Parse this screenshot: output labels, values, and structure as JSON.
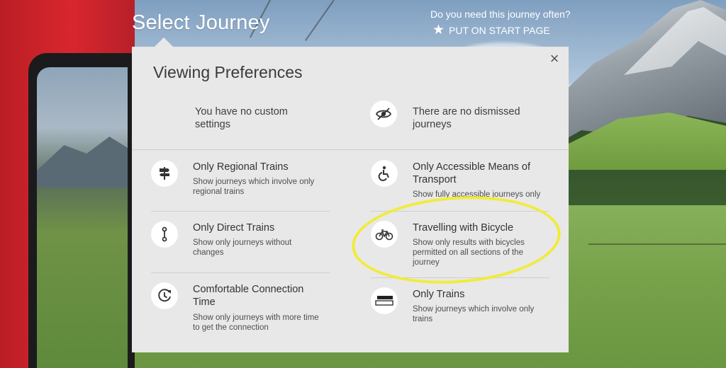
{
  "header": {
    "title": "Select Journey",
    "often_question": "Do you need this journey often?",
    "start_page_label": "PUT ON START PAGE"
  },
  "panel": {
    "title": "Viewing Preferences",
    "close_label": "×",
    "summary_left": "You have no custom settings",
    "summary_right": "There are no dismissed journeys",
    "options": [
      {
        "icon": "signpost-icon",
        "title": "Only Regional Trains",
        "description": "Show journeys which involve only regional trains"
      },
      {
        "icon": "accessible-icon",
        "title": "Only Accessible Means of Transport",
        "description": "Show fully accessible journeys only"
      },
      {
        "icon": "direct-route-icon",
        "title": "Only Direct Trains",
        "description": "Show only journeys without changes"
      },
      {
        "icon": "bicycle-icon",
        "title": "Travelling with Bicycle",
        "description": "Show only results with bicycles permitted on all sections of the journey"
      },
      {
        "icon": "clock-icon",
        "title": "Comfortable Connection Time",
        "description": "Show only journeys with more time to get the connection"
      },
      {
        "icon": "train-icon",
        "title": "Only Trains",
        "description": "Show journeys which involve only trains"
      }
    ]
  },
  "colors": {
    "panel_background": "#e8e8e8",
    "highlight": "#f2eb3a",
    "train_red": "#d8262e"
  }
}
